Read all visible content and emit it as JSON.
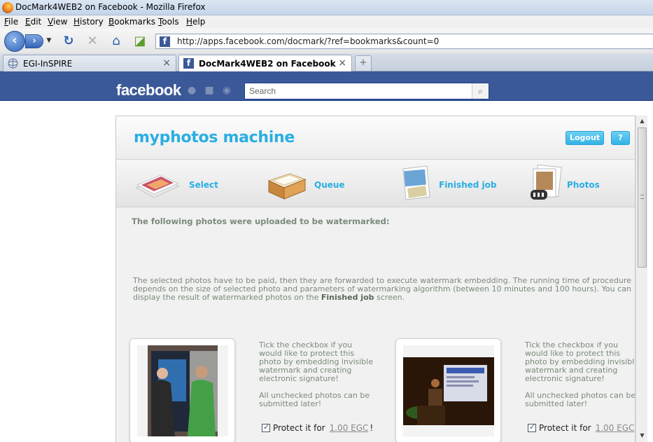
{
  "window": {
    "title": "DocMark4WEB2 on Facebook - Mozilla Firefox"
  },
  "menu": [
    {
      "label": "File"
    },
    {
      "label": "Edit"
    },
    {
      "label": "View"
    },
    {
      "label": "History"
    },
    {
      "label": "Bookmarks"
    },
    {
      "label": "Tools"
    },
    {
      "label": "Help"
    }
  ],
  "navbar": {
    "url": "http://apps.facebook.com/docmark/?ref=bookmarks&count=0"
  },
  "tabs": [
    {
      "label": "EGI-InSPIRE",
      "close": "×"
    },
    {
      "label": "DocMark4WEB2 on Facebook",
      "close": "×"
    }
  ],
  "newtab": "+",
  "facebook": {
    "logo": "facebook",
    "search_placeholder": "Search"
  },
  "app": {
    "title": "myphotos machine",
    "logout_label": "Logout",
    "help_label": "?",
    "nav": [
      {
        "label": "Select"
      },
      {
        "label": "Queue"
      },
      {
        "label": "Finished job"
      },
      {
        "label": "Photos"
      }
    ],
    "heading": "The following photos were uploaded to be watermarked:",
    "paragraph_pre": "The selected photos have to be paid, then they are forwarded to execute watermark embedding. The running time of procedure depends on the size of selected photo and parameters of watermarking algorithm (between 10 minutes and 100 hours). You can display the result of watermarked photos on the",
    "paragraph_bold": "Finished job",
    "paragraph_post": "screen.",
    "cards": [
      {
        "tick_text": "Tick the checkbox if you would like to protect this photo by embedding invisible watermark and creating electronic signature!",
        "later_text": "All unchecked photos can be submitted later!",
        "protect_label": "Protect it for",
        "price": "1.00 EGC",
        "suffix": "!"
      },
      {
        "tick_text": "Tick the checkbox if you would like to protect this photo by embedding invisible watermark and creating electronic signature!",
        "later_text": "All unchecked photos can be submitted later!",
        "protect_label": "Protect it for",
        "price": "1.00 EGC",
        "suffix": "!"
      }
    ]
  },
  "colors": {
    "facebook_blue": "#3b5998",
    "app_accent": "#29aee3",
    "muted_text": "#7a8a7a"
  }
}
